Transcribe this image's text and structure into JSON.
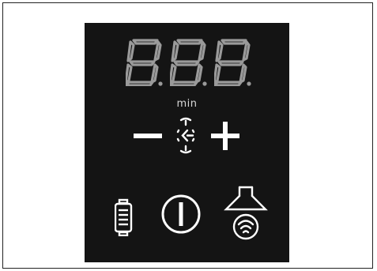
{
  "display": {
    "digits": [
      "8",
      "8",
      "8"
    ],
    "unit_label": "min"
  },
  "controls": {
    "minus": "minus",
    "timer": "timer",
    "plus": "plus",
    "filter": "filter",
    "power": "power",
    "hood": "hood"
  },
  "colors": {
    "panel_bg": "#141414",
    "segments_dim": "#9a9a9a",
    "icon_white": "#ffffff"
  },
  "icons": [
    "minus-icon",
    "timer-icon",
    "plus-icon",
    "grease-filter-icon",
    "power-icon",
    "hood-fan-icon"
  ]
}
